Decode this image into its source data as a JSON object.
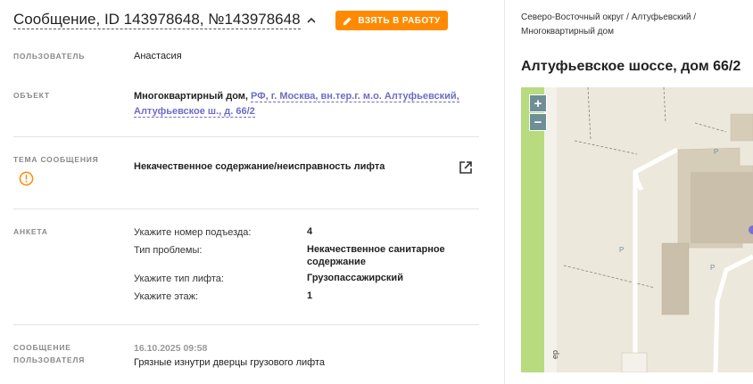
{
  "header": {
    "title": "Сообщение, ID 143978648, №143978648",
    "take_button_label": "ВЗЯТЬ В РАБОТУ"
  },
  "user": {
    "label": "ПОЛЬЗОВАТЕЛЬ",
    "value": "Анастасия"
  },
  "object": {
    "label": "ОБЪЕКТ",
    "type": "Многоквартирный дом,",
    "address_line1": "РФ, г. Москва, вн.тер.г. м.о. Алтуфьевский,",
    "address_line2": "Алтуфьевское ш., д. 66/2"
  },
  "topic": {
    "label": "ТЕМА СООБЩЕНИЯ",
    "value": "Некачественное содержание/неисправность лифта"
  },
  "survey": {
    "label": "АНКЕТА",
    "rows": [
      {
        "q": "Укажите номер подъезда:",
        "a": "4"
      },
      {
        "q": "Тип проблемы:",
        "a_line1": "Некачественное санитарное",
        "a_line2": "содержание"
      },
      {
        "q": "Укажите тип лифта:",
        "a": "Грузопассажирский"
      },
      {
        "q": "Укажите этаж:",
        "a": "1"
      }
    ]
  },
  "user_message": {
    "label_line1": "СООБЩЕНИЕ",
    "label_line2": "ПОЛЬЗОВАТЕЛЯ",
    "date": "16.10.2025 09:58",
    "text": "Грязные изнутри дверцы грузового лифта"
  },
  "location": {
    "breadcrumb_line1": "Северо-Восточный округ / Алтуфьевский /",
    "breadcrumb_line2": "Многоквартирный дом",
    "address": "Алтуфьевское шоссе, дом 66/2"
  },
  "map": {
    "zoom_in": "+",
    "zoom_out": "−",
    "parking_marker": "P",
    "street_fragment": "ер",
    "colors": {
      "accent": "#ff8a00",
      "link": "#6d6cc8",
      "park": "#b9db7f",
      "building": "#d6cdb9"
    }
  }
}
